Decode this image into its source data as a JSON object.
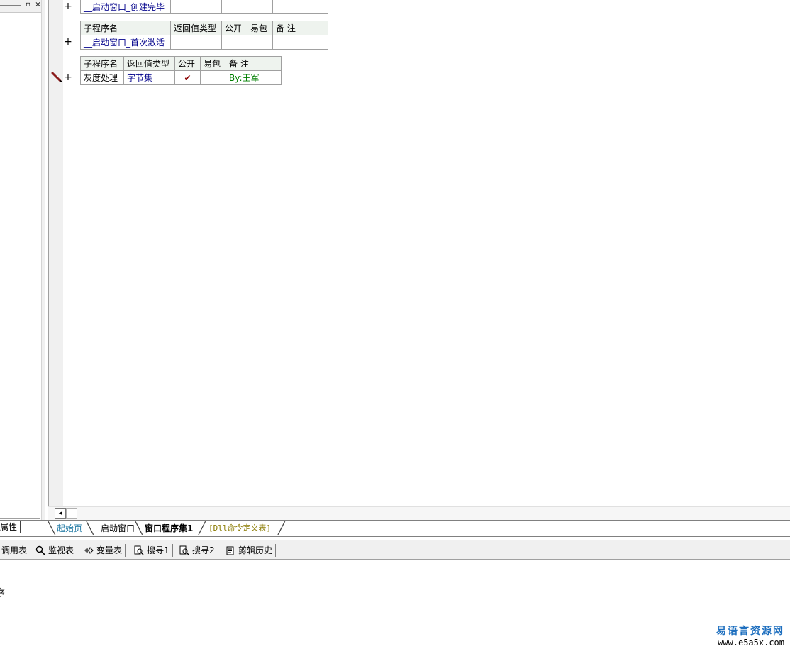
{
  "left_panel": {
    "restore_glyph": "▫",
    "close_glyph": "×",
    "tab_label": "属性"
  },
  "tables": [
    {
      "rows": [
        {
          "name": "__启动窗口_创建完毕",
          "return_type": "",
          "public": "",
          "easy_pkg": "",
          "note": ""
        }
      ]
    },
    {
      "header": {
        "name": "子程序名",
        "return_type": "返回值类型",
        "public": "公开",
        "easy_pkg": "易包",
        "note": "备 注"
      },
      "rows": [
        {
          "name": "__启动窗口_首次激活",
          "return_type": "",
          "public": "",
          "easy_pkg": "",
          "note": ""
        }
      ]
    },
    {
      "header": {
        "name": "子程序名",
        "return_type": "返回值类型",
        "public": "公开",
        "easy_pkg": "易包",
        "note": "备 注"
      },
      "rows": [
        {
          "name": "灰度处理",
          "return_type": "字节集",
          "public": "✔",
          "easy_pkg": "",
          "note": "By:王军"
        }
      ]
    }
  ],
  "expand_glyph": "+",
  "scroll": {
    "left_arrow": "◂"
  },
  "doc_tabs": [
    {
      "label": "起始页"
    },
    {
      "label": "_启动窗口"
    },
    {
      "label": "窗口程序集1"
    },
    {
      "label": "[Dll命令定义表]"
    }
  ],
  "toolbar": {
    "items": [
      {
        "label": "调用表",
        "icon": "call-table-icon"
      },
      {
        "label": "监视表",
        "icon": "magnifier-icon"
      },
      {
        "label": "变量表",
        "icon": "variables-icon"
      },
      {
        "label": "搜寻1",
        "icon": "search-doc-icon"
      },
      {
        "label": "搜寻2",
        "icon": "search-doc-icon"
      },
      {
        "label": "剪辑历史",
        "icon": "clipboard-icon"
      }
    ]
  },
  "output": {
    "text": "序"
  },
  "watermark": {
    "title": "易语言资源网",
    "url": "www.e5a5x.com"
  }
}
